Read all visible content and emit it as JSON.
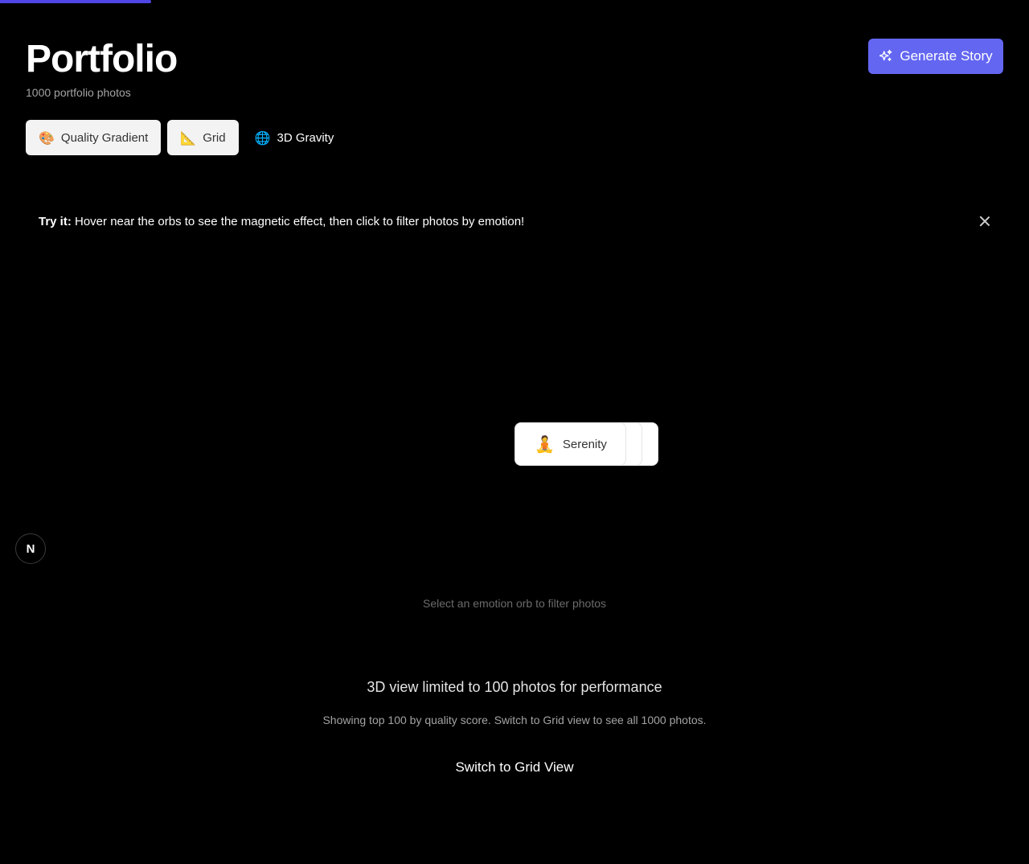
{
  "header": {
    "title": "Portfolio",
    "subtitle": "1000 portfolio photos",
    "generate_label": "Generate Story",
    "accent_color": "#6366f1"
  },
  "progress": {
    "fraction": 0.147,
    "color": "#4f46e5"
  },
  "view_tabs": [
    {
      "emoji": "🎨",
      "label": "Quality Gradient",
      "active": false
    },
    {
      "emoji": "📐",
      "label": "Grid",
      "active": false
    },
    {
      "emoji": "🌐",
      "label": "3D Gravity",
      "active": true
    }
  ],
  "tip": {
    "prefix": "Try it:",
    "text": " Hover near the orbs to see the magnetic effect, then click to filter photos by emotion!"
  },
  "orb": {
    "emoji": "🧘",
    "label": "Serenity"
  },
  "badge": {
    "letter": "N"
  },
  "hint": "Select an emotion orb to filter photos",
  "limit": {
    "title": "3D view limited to 100 photos for performance",
    "description": "Showing top 100 by quality score. Switch to Grid view to see all 1000 photos.",
    "switch_label": "Switch to Grid View"
  }
}
